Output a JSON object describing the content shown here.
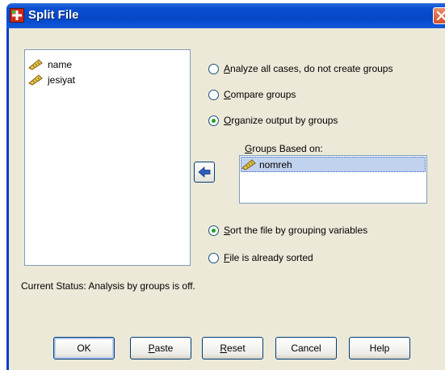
{
  "window": {
    "title": "Split File"
  },
  "variables": [
    {
      "label": "name",
      "icon": "ruler-icon"
    },
    {
      "label": "jesiyat",
      "icon": "ruler-icon"
    }
  ],
  "mode_options": {
    "analyze_all": {
      "prefix": "",
      "mnemonic": "A",
      "rest": "nalyze all cases, do not create groups",
      "selected": false
    },
    "compare": {
      "prefix": "",
      "mnemonic": "C",
      "rest": "ompare groups",
      "selected": false
    },
    "organize": {
      "prefix": "",
      "mnemonic": "O",
      "rest": "rganize output by groups",
      "selected": true
    }
  },
  "groups": {
    "label_prefix": "",
    "label_mnemonic": "G",
    "label_rest": "roups Based on:",
    "items": [
      {
        "label": "nomreh",
        "icon": "ruler-icon"
      }
    ]
  },
  "sort_options": {
    "sort_by_grouping": {
      "prefix": "",
      "mnemonic": "S",
      "rest": "ort the file by grouping variables",
      "selected": true
    },
    "already_sorted": {
      "prefix": "",
      "mnemonic": "F",
      "rest": "ile is already sorted",
      "selected": false
    }
  },
  "status": "Current Status: Analysis by groups is off.",
  "buttons": {
    "ok": {
      "prefix": "OK",
      "mnemonic": "",
      "rest": ""
    },
    "paste": {
      "prefix": "",
      "mnemonic": "P",
      "rest": "aste"
    },
    "reset": {
      "prefix": "",
      "mnemonic": "R",
      "rest": "eset"
    },
    "cancel": {
      "prefix": "Cancel",
      "mnemonic": "",
      "rest": ""
    },
    "help": {
      "prefix": "Help",
      "mnemonic": "",
      "rest": ""
    }
  },
  "colors": {
    "title_bar": "#0a4fd1",
    "dialog_face": "#ece9d8",
    "selection": "#c1d2ee",
    "radio_dot": "#21a121",
    "close_button": "#d4502b"
  }
}
